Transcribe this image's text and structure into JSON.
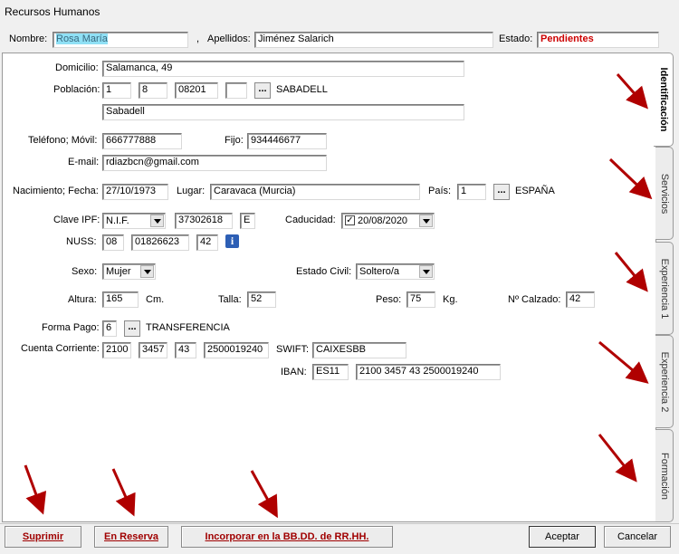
{
  "window": {
    "title": "Recursos Humanos"
  },
  "header": {
    "nombre_label": "Nombre:",
    "nombre_value": "Rosa María",
    "apellidos_label": "Apellidos:",
    "apellidos_value": "Jiménez Salarich",
    "estado_label": "Estado:",
    "estado_value": "Pendientes"
  },
  "form": {
    "domicilio_label": "Domicilio:",
    "domicilio_value": "Salamanca, 49",
    "poblacion_label": "Población:",
    "poblacion_1": "1",
    "poblacion_2": "8",
    "poblacion_3": "08201",
    "poblacion_4": "",
    "poblacion_name": "SABADELL",
    "poblacion_city": "Sabadell",
    "telefono_label": "Teléfono; Móvil:",
    "telefono_value": "666777888",
    "fijo_label": "Fijo:",
    "fijo_value": "934446677",
    "email_label": "E-mail:",
    "email_value": "rdiazbcn@gmail.com",
    "nacimiento_label": "Nacimiento; Fecha:",
    "nacimiento_value": "27/10/1973",
    "lugar_label": "Lugar:",
    "lugar_value": "Caravaca (Murcia)",
    "pais_label": "País:",
    "pais_value": "1",
    "pais_name": "ESPAÑA",
    "clave_label": "Clave IPF:",
    "clave_type": "N.I.F.",
    "clave_num": "37302618",
    "clave_letter": "E",
    "caducidad_label": "Caducidad:",
    "caducidad_value": "20/08/2020",
    "caducidad_checked": true,
    "nuss_label": "NUSS:",
    "nuss_1": "08",
    "nuss_2": "01826623",
    "nuss_3": "42",
    "sexo_label": "Sexo:",
    "sexo_value": "Mujer",
    "civil_label": "Estado Civil:",
    "civil_value": "Soltero/a",
    "altura_label": "Altura:",
    "altura_value": "165",
    "altura_unit": "Cm.",
    "talla_label": "Talla:",
    "talla_value": "52",
    "peso_label": "Peso:",
    "peso_value": "75",
    "peso_unit": "Kg.",
    "calzado_label": "Nº Calzado:",
    "calzado_value": "42",
    "pago_label": "Forma Pago:",
    "pago_value": "6",
    "pago_name": "TRANSFERENCIA",
    "cuenta_label": "Cuenta Corriente:",
    "cuenta_1": "2100",
    "cuenta_2": "3457",
    "cuenta_3": "43",
    "cuenta_4": "2500019240",
    "swift_label": "SWIFT:",
    "swift_value": "CAIXESBB",
    "iban_label": "IBAN:",
    "iban_prefix": "ES11",
    "iban_value": "2100 3457 43 2500019240",
    "ellipsis": "...",
    "info_icon": "i"
  },
  "tabs": [
    "Identificación",
    "Servicios",
    "Experiencia 1",
    "Experiencia 2",
    "Formación"
  ],
  "buttons": {
    "suprimir": "Suprimir",
    "reserva": "En Reserva",
    "incorporar": "Incorporar en la BB.DD. de RR.HH.",
    "aceptar": "Aceptar",
    "cancelar": "Cancelar"
  },
  "colors": {
    "selection": "#8fe0f5",
    "estado": "#cc0000",
    "arrow": "#b00000",
    "info": "#2d5fb5"
  }
}
